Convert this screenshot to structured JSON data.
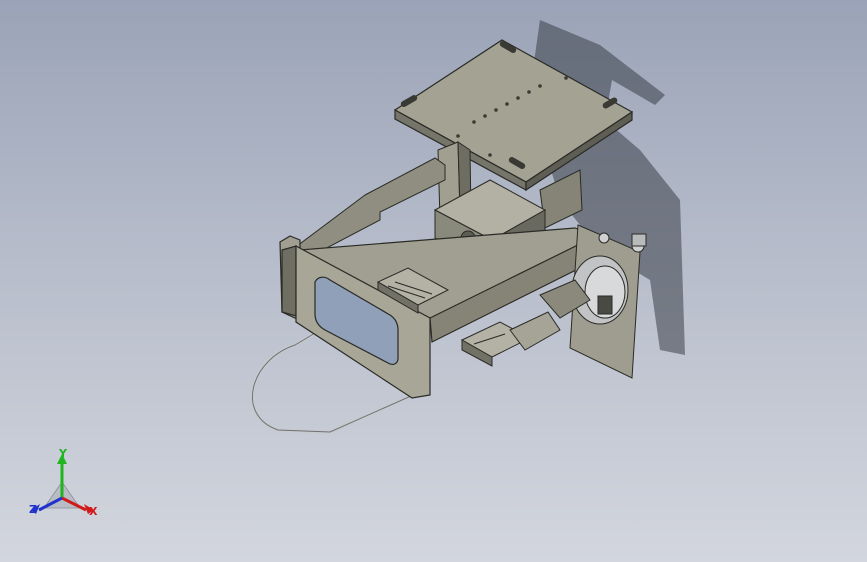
{
  "colors": {
    "background_top": "#9aa3b7",
    "background_bottom": "#d3d6de",
    "part_face": "#9c9b8c",
    "part_dark": "#6c6b5f",
    "part_edge": "#2a2a26",
    "axis_x": "#d11a1a",
    "axis_y": "#1fb51f",
    "axis_z": "#2233cc"
  },
  "triad": {
    "x_label": "X",
    "y_label": "Y",
    "z_label": "Z",
    "x_color": "#d11a1a",
    "y_color": "#1fb51f",
    "z_color": "#2233cc"
  }
}
